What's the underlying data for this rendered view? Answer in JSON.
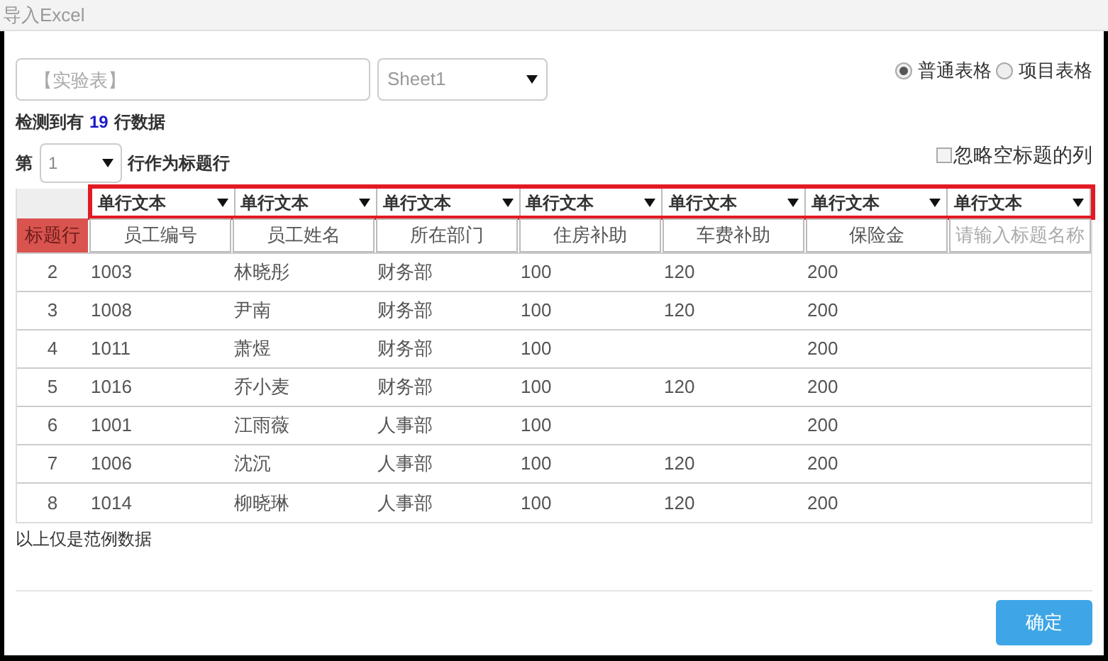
{
  "window": {
    "title": "导入Excel"
  },
  "file_field": {
    "placeholder": "【实验表】"
  },
  "sheet_select": {
    "value": "Sheet1"
  },
  "table_types": [
    {
      "label": "普通表格",
      "selected": true
    },
    {
      "label": "项目表格",
      "selected": false
    }
  ],
  "detected": {
    "prefix": "检测到有",
    "count": "19",
    "suffix": "行数据"
  },
  "header_row": {
    "prefix": "第",
    "value": "1",
    "suffix": "行作为标题行"
  },
  "ignore_empty": {
    "label": "忽略空标题的列",
    "checked": false
  },
  "column_types": [
    "单行文本",
    "单行文本",
    "单行文本",
    "单行文本",
    "单行文本",
    "单行文本",
    "单行文本"
  ],
  "title_row_label": "标题行",
  "column_titles": [
    {
      "value": "员工编号"
    },
    {
      "value": "员工姓名"
    },
    {
      "value": "所在部门"
    },
    {
      "value": "住房补助"
    },
    {
      "value": "车费补助"
    },
    {
      "value": "保险金"
    },
    {
      "placeholder": "请输入标题名称"
    }
  ],
  "rows": [
    {
      "number": "2",
      "cells": [
        "1003",
        "林晓彤",
        "财务部",
        "100",
        "120",
        "200"
      ]
    },
    {
      "number": "3",
      "cells": [
        "1008",
        "尹南",
        "财务部",
        "100",
        "120",
        "200"
      ]
    },
    {
      "number": "4",
      "cells": [
        "1011",
        "萧煜",
        "财务部",
        "100",
        "",
        "200"
      ]
    },
    {
      "number": "5",
      "cells": [
        "1016",
        "乔小麦",
        "财务部",
        "100",
        "120",
        "200"
      ]
    },
    {
      "number": "6",
      "cells": [
        "1001",
        "江雨薇",
        "人事部",
        "100",
        "",
        "200"
      ]
    },
    {
      "number": "7",
      "cells": [
        "1006",
        "沈沉",
        "人事部",
        "100",
        "120",
        "200"
      ]
    },
    {
      "number": "8",
      "cells": [
        "1014",
        "柳晓琳",
        "人事部",
        "100",
        "120",
        "200"
      ]
    }
  ],
  "note": "以上仅是范例数据",
  "buttons": [
    "确定"
  ]
}
